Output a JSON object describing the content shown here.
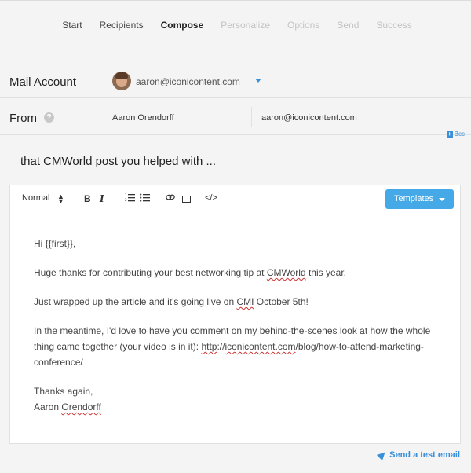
{
  "steps": [
    {
      "label": "Start",
      "state": "done"
    },
    {
      "label": "Recipients",
      "state": "done"
    },
    {
      "label": "Compose",
      "state": "active"
    },
    {
      "label": "Personalize",
      "state": "todo"
    },
    {
      "label": "Options",
      "state": "todo"
    },
    {
      "label": "Send",
      "state": "todo"
    },
    {
      "label": "Success",
      "state": "todo"
    }
  ],
  "mail_account": {
    "label": "Mail Account",
    "email": "aaron@iconicontent.com"
  },
  "from": {
    "label": "From",
    "help_icon": "?",
    "name": "Aaron Orendorff",
    "email": "aaron@iconicontent.com",
    "bcc_icon": "+",
    "bcc_label": "Bcc"
  },
  "subject": "that CMWorld post you helped with ...",
  "toolbar": {
    "format": "Normal",
    "bold": "B",
    "italic": "I",
    "ordered_list": "⒈≡",
    "bullet_list": "☰",
    "link": "🔗",
    "code": "</>",
    "templates_label": "Templates"
  },
  "email_body": {
    "greeting": "Hi {{first}},",
    "p1_a": "Huge thanks for contributing your best networking tip at ",
    "p1_cmworld": "CMWorld",
    "p1_b": " this year.",
    "p2_a": "Just wrapped up the article and it's going live on ",
    "p2_cmi": "CMI",
    "p2_b": " October 5th!",
    "p3_a": "In the meantime, I'd love to have you comment on my behind-the-scenes look at how the whole thing came together (your video is in it): ",
    "p3_link_a": "http",
    "p3_link_b": "://",
    "p3_link_c": "iconicontent.com",
    "p3_link_d": "/blog/how-to-attend-marketing-conference/",
    "closing": "Thanks again,",
    "sig_first": "Aaron ",
    "sig_last": "Orendorff"
  },
  "test_email_label": "Send a test email",
  "colors": {
    "accent": "#45a9e7",
    "link": "#3a8fd9",
    "background": "#f4f4f4"
  }
}
